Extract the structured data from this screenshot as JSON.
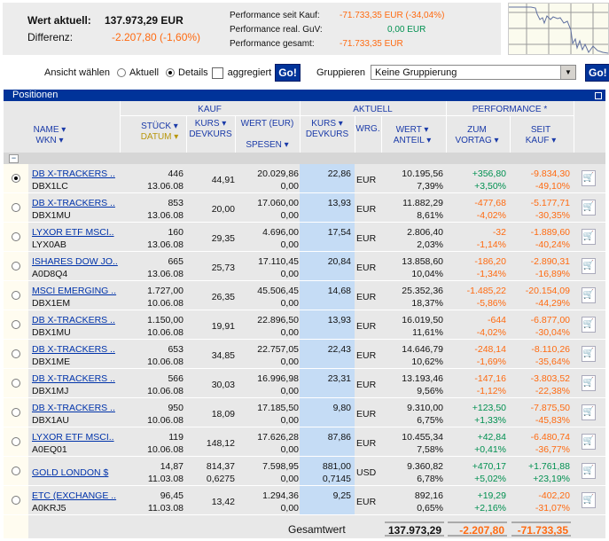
{
  "summary": {
    "wert_label": "Wert aktuell:",
    "wert_value": "137.973,29 EUR",
    "diff_label": "Differenz:",
    "diff_value": "-2.207,80 (-1,60%)",
    "perf_kauf_label": "Performance seit Kauf:",
    "perf_kauf_value": "-71.733,35 EUR (-34,04%)",
    "perf_real_label": "Performance real. GuV:",
    "perf_real_value": "0,00 EUR",
    "perf_ges_label": "Performance gesamt:",
    "perf_ges_value": "-71.733,35 EUR"
  },
  "controls": {
    "ansicht_label": "Ansicht wählen",
    "aktuell": "Aktuell",
    "details": "Details",
    "aggregiert": "aggregiert",
    "go": "Go!",
    "gruppieren_label": "Gruppieren",
    "gruppieren_value": "Keine Gruppierung"
  },
  "section_title": "Positionen",
  "headers": {
    "kauf": "KAUF",
    "aktuell": "AKTUELL",
    "performance": "PERFORMANCE *",
    "name": "NAME ▾",
    "wkn": "WKN ▾",
    "stueck": "STÜCK ▾",
    "datum": "DATUM ▾",
    "kurs": "KURS ▾",
    "devkurs": "DEVKURS",
    "wert_eur": "WERT (EUR)",
    "spesen": "SPESEN ▾",
    "akurs": "KURS ▾",
    "adevkurs": "DEVKURS",
    "wrg": "WRG.",
    "wert": "WERT ▾",
    "anteil": "ANTEIL ▾",
    "zum": "ZUM",
    "vortag": "VORTAG ▾",
    "seit": "SEIT",
    "kauf2": "KAUF ▾"
  },
  "rows": [
    {
      "name": "DB X-TRACKERS ..",
      "wkn": "DBX1LC",
      "stueck": "446",
      "datum": "13.06.08",
      "kurs": "44,91",
      "devkurs": "",
      "wert": "20.029,86",
      "spesen": "0,00",
      "akurs": "22,86",
      "adev": "",
      "wrg": "EUR",
      "awert": "10.195,56",
      "anteil": "7,39%",
      "vortag": "+356,80",
      "vortag_pct": "+3,50%",
      "seit": "-9.834,30",
      "seit_pct": "-49,10%",
      "selected": true
    },
    {
      "name": "DB X-TRACKERS ..",
      "wkn": "DBX1MU",
      "stueck": "853",
      "datum": "13.06.08",
      "kurs": "20,00",
      "devkurs": "",
      "wert": "17.060,00",
      "spesen": "0,00",
      "akurs": "13,93",
      "adev": "",
      "wrg": "EUR",
      "awert": "11.882,29",
      "anteil": "8,61%",
      "vortag": "-477,68",
      "vortag_pct": "-4,02%",
      "seit": "-5.177,71",
      "seit_pct": "-30,35%"
    },
    {
      "name": "LYXOR ETF MSCI..",
      "wkn": "LYX0AB",
      "stueck": "160",
      "datum": "13.06.08",
      "kurs": "29,35",
      "devkurs": "",
      "wert": "4.696,00",
      "spesen": "0,00",
      "akurs": "17,54",
      "adev": "",
      "wrg": "EUR",
      "awert": "2.806,40",
      "anteil": "2,03%",
      "vortag": "-32",
      "vortag_pct": "-1,14%",
      "seit": "-1.889,60",
      "seit_pct": "-40,24%"
    },
    {
      "name": "ISHARES DOW JO..",
      "wkn": "A0D8Q4",
      "stueck": "665",
      "datum": "13.06.08",
      "kurs": "25,73",
      "devkurs": "",
      "wert": "17.110,45",
      "spesen": "0,00",
      "akurs": "20,84",
      "adev": "",
      "wrg": "EUR",
      "awert": "13.858,60",
      "anteil": "10,04%",
      "vortag": "-186,20",
      "vortag_pct": "-1,34%",
      "seit": "-2.890,31",
      "seit_pct": "-16,89%"
    },
    {
      "name": "MSCI EMERGING ..",
      "wkn": "DBX1EM",
      "stueck": "1.727,00",
      "datum": "10.06.08",
      "kurs": "26,35",
      "devkurs": "",
      "wert": "45.506,45",
      "spesen": "0,00",
      "akurs": "14,68",
      "adev": "",
      "wrg": "EUR",
      "awert": "25.352,36",
      "anteil": "18,37%",
      "vortag": "-1.485,22",
      "vortag_pct": "-5,86%",
      "seit": "-20.154,09",
      "seit_pct": "-44,29%"
    },
    {
      "name": "DB X-TRACKERS ..",
      "wkn": "DBX1MU",
      "stueck": "1.150,00",
      "datum": "10.06.08",
      "kurs": "19,91",
      "devkurs": "",
      "wert": "22.896,50",
      "spesen": "0,00",
      "akurs": "13,93",
      "adev": "",
      "wrg": "EUR",
      "awert": "16.019,50",
      "anteil": "11,61%",
      "vortag": "-644",
      "vortag_pct": "-4,02%",
      "seit": "-6.877,00",
      "seit_pct": "-30,04%"
    },
    {
      "name": "DB X-TRACKERS ..",
      "wkn": "DBX1ME",
      "stueck": "653",
      "datum": "10.06.08",
      "kurs": "34,85",
      "devkurs": "",
      "wert": "22.757,05",
      "spesen": "0,00",
      "akurs": "22,43",
      "adev": "",
      "wrg": "EUR",
      "awert": "14.646,79",
      "anteil": "10,62%",
      "vortag": "-248,14",
      "vortag_pct": "-1,69%",
      "seit": "-8.110,26",
      "seit_pct": "-35,64%"
    },
    {
      "name": "DB X-TRACKERS ..",
      "wkn": "DBX1MJ",
      "stueck": "566",
      "datum": "10.06.08",
      "kurs": "30,03",
      "devkurs": "",
      "wert": "16.996,98",
      "spesen": "0,00",
      "akurs": "23,31",
      "adev": "",
      "wrg": "EUR",
      "awert": "13.193,46",
      "anteil": "9,56%",
      "vortag": "-147,16",
      "vortag_pct": "-1,12%",
      "seit": "-3.803,52",
      "seit_pct": "-22,38%"
    },
    {
      "name": "DB X-TRACKERS ..",
      "wkn": "DBX1AU",
      "stueck": "950",
      "datum": "10.06.08",
      "kurs": "18,09",
      "devkurs": "",
      "wert": "17.185,50",
      "spesen": "0,00",
      "akurs": "9,80",
      "adev": "",
      "wrg": "EUR",
      "awert": "9.310,00",
      "anteil": "6,75%",
      "vortag": "+123,50",
      "vortag_pct": "+1,33%",
      "seit": "-7.875,50",
      "seit_pct": "-45,83%"
    },
    {
      "name": "LYXOR ETF MSCI..",
      "wkn": "A0EQ01",
      "stueck": "119",
      "datum": "10.06.08",
      "kurs": "148,12",
      "devkurs": "",
      "wert": "17.626,28",
      "spesen": "0,00",
      "akurs": "87,86",
      "adev": "",
      "wrg": "EUR",
      "awert": "10.455,34",
      "anteil": "7,58%",
      "vortag": "+42,84",
      "vortag_pct": "+0,41%",
      "seit": "-6.480,74",
      "seit_pct": "-36,77%"
    },
    {
      "name": "GOLD LONDON $",
      "wkn": "",
      "stueck": "14,87",
      "datum": "11.03.08",
      "kurs": "814,37",
      "devkurs": "0,6275",
      "wert": "7.598,95",
      "spesen": "0,00",
      "akurs": "881,00",
      "adev": "0,7145",
      "wrg": "USD",
      "awert": "9.360,82",
      "anteil": "6,78%",
      "vortag": "+470,17",
      "vortag_pct": "+5,02%",
      "seit": "+1.761,88",
      "seit_pct": "+23,19%"
    },
    {
      "name": "ETC (EXCHANGE ..",
      "wkn": "A0KRJ5",
      "stueck": "96,45",
      "datum": "11.03.08",
      "kurs": "13,42",
      "devkurs": "",
      "wert": "1.294,36",
      "spesen": "0,00",
      "akurs": "9,25",
      "adev": "",
      "wrg": "EUR",
      "awert": "892,16",
      "anteil": "0,65%",
      "vortag": "+19,29",
      "vortag_pct": "+2,16%",
      "seit": "-402,20",
      "seit_pct": "-31,07%"
    }
  ],
  "totals": {
    "label": "Gesamtwert",
    "wert": "137.973,29",
    "vortag": "-2.207,80",
    "seit": "-71.733,35"
  },
  "colors": {
    "brand": "#003399",
    "positive": "#009050",
    "negative": "#ff6a10",
    "highlight": "#c5dcf5"
  }
}
